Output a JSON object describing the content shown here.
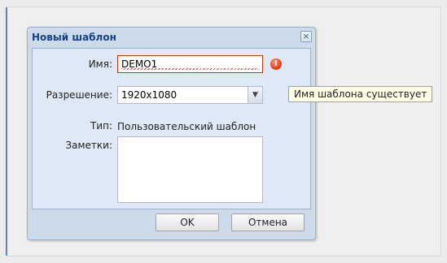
{
  "dialog": {
    "title": "Новый шаблон",
    "close_label": "×",
    "fields": {
      "name_label": "Имя:",
      "name_value": "DEMO1",
      "resolution_label": "Разрешение:",
      "resolution_value": "1920x1080",
      "type_label": "Тип:",
      "type_value": "Пользовательский шаблон",
      "notes_label": "Заметки:",
      "notes_value": ""
    },
    "buttons": {
      "ok": "OK",
      "cancel": "Отмена"
    }
  },
  "validation": {
    "error_icon_glyph": "!",
    "tooltip": "Имя шаблона существует"
  },
  "icons": {
    "close": "close-icon",
    "error": "error-icon",
    "dropdown": "chevron-down-icon"
  },
  "colors": {
    "title_text": "#15428b",
    "error_border": "#cc3300",
    "error_icon": "#e2411a",
    "dialog_frame": "#cddaea",
    "dialog_body": "#dfe8f6",
    "tooltip_bg": "#ffffe7"
  }
}
